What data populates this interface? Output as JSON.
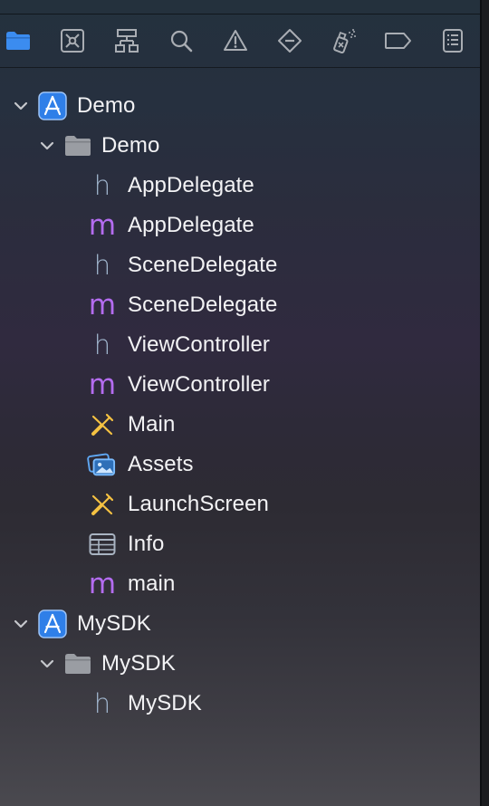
{
  "navigator_tabs": [
    {
      "name": "project-navigator",
      "icon": "folder-icon",
      "active": true
    },
    {
      "name": "source-control-navigator",
      "icon": "source-control-icon",
      "active": false
    },
    {
      "name": "symbol-navigator",
      "icon": "hierarchy-icon",
      "active": false
    },
    {
      "name": "find-navigator",
      "icon": "search-icon",
      "active": false
    },
    {
      "name": "issue-navigator",
      "icon": "warning-icon",
      "active": false
    },
    {
      "name": "test-navigator",
      "icon": "diamond-icon",
      "active": false
    },
    {
      "name": "debug-navigator",
      "icon": "spray-icon",
      "active": false
    },
    {
      "name": "breakpoint-navigator",
      "icon": "breakpoint-icon",
      "active": false
    },
    {
      "name": "report-navigator",
      "icon": "report-icon",
      "active": false
    }
  ],
  "tree": {
    "demo_project": {
      "label": "Demo",
      "icon": "xcode-project-icon",
      "expanded": true
    },
    "demo_group": {
      "label": "Demo",
      "icon": "folder-icon",
      "expanded": true
    },
    "files": [
      {
        "label": "AppDelegate",
        "icon": "header-file-icon",
        "glyph": "h"
      },
      {
        "label": "AppDelegate",
        "icon": "objc-file-icon",
        "glyph": "m"
      },
      {
        "label": "SceneDelegate",
        "icon": "header-file-icon",
        "glyph": "h"
      },
      {
        "label": "SceneDelegate",
        "icon": "objc-file-icon",
        "glyph": "m"
      },
      {
        "label": "ViewController",
        "icon": "header-file-icon",
        "glyph": "h"
      },
      {
        "label": "ViewController",
        "icon": "objc-file-icon",
        "glyph": "m"
      },
      {
        "label": "Main",
        "icon": "storyboard-icon"
      },
      {
        "label": "Assets",
        "icon": "asset-catalog-icon"
      },
      {
        "label": "LaunchScreen",
        "icon": "storyboard-icon"
      },
      {
        "label": "Info",
        "icon": "plist-icon"
      },
      {
        "label": "main",
        "icon": "objc-file-icon",
        "glyph": "m"
      }
    ],
    "sdk_project": {
      "label": "MySDK",
      "icon": "xcode-project-icon",
      "expanded": true
    },
    "sdk_group": {
      "label": "MySDK",
      "icon": "folder-icon",
      "expanded": true
    },
    "sdk_files": [
      {
        "label": "MySDK",
        "icon": "header-file-icon",
        "glyph": "h"
      }
    ]
  },
  "colors": {
    "accent": "#3b8cf0",
    "header_glyph": "#9fb4cc",
    "impl_glyph": "#b46cf0",
    "storyboard": "#f5c242",
    "toolbar_icon": "#a9adb3"
  }
}
